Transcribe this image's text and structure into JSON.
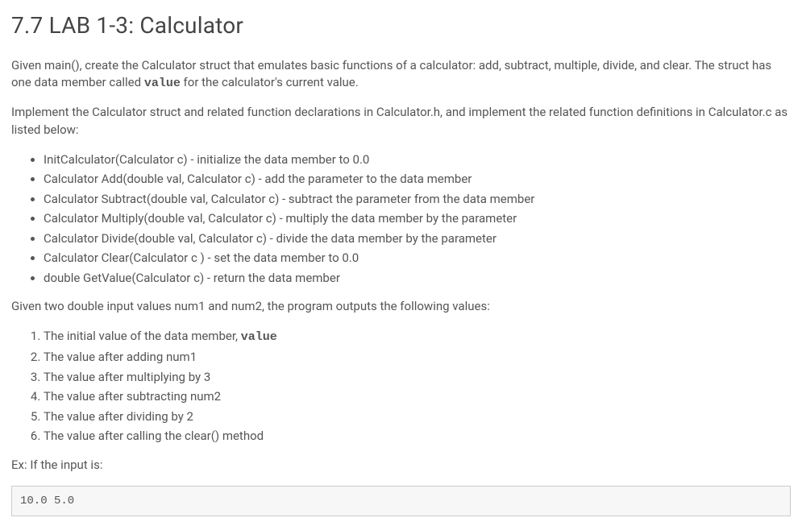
{
  "title": "7.7 LAB 1-3: Calculator",
  "para1_a": "Given main(), create the Calculator struct that emulates basic functions of a calculator: add, subtract, multiple, divide, and clear. The struct has one data member called ",
  "para1_code": "value",
  "para1_b": " for the calculator's current value.",
  "para2": "Implement the Calculator struct and related function declarations in Calculator.h, and implement the related function definitions in Calculator.c as listed below:",
  "bullets": [
    "InitCalculator(Calculator c) - initialize the data member to 0.0",
    "Calculator Add(double val, Calculator c) - add the parameter to the data member",
    "Calculator Subtract(double val, Calculator c) - subtract the parameter from the data member",
    "Calculator Multiply(double val, Calculator c) - multiply the data member by the parameter",
    "Calculator Divide(double val, Calculator c) - divide the data member by the parameter",
    "Calculator Clear(Calculator c ) - set the data member to 0.0",
    "double GetValue(Calculator c) - return the data member"
  ],
  "para3": "Given two double input values num1 and num2, the program outputs the following values:",
  "steps": {
    "s1a": "The initial value of the data member, ",
    "s1code": "value",
    "s2": "The value after adding num1",
    "s3": "The value after multiplying by 3",
    "s4": "The value after subtracting num2",
    "s5": "The value after dividing by 2",
    "s6": "The value after calling the clear() method"
  },
  "para4": "Ex: If the input is:",
  "example_input": "10.0 5.0"
}
